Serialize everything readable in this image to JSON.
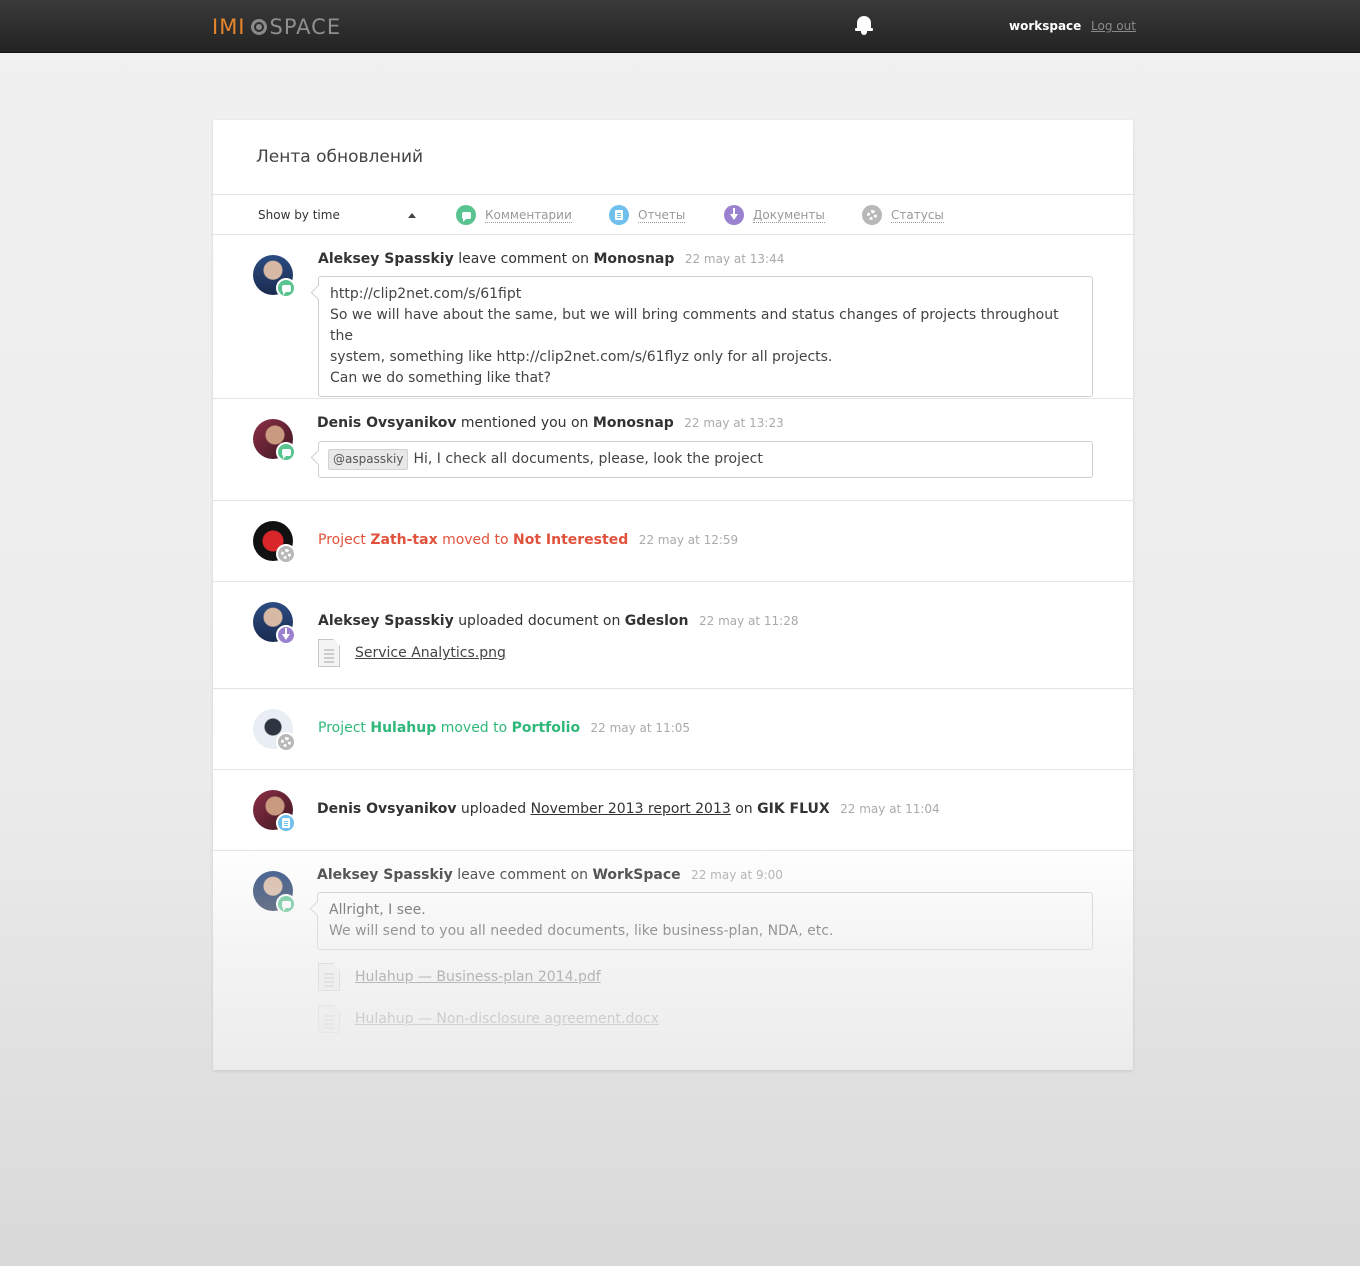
{
  "header": {
    "logo_left": "IMI",
    "logo_right": "SPACE",
    "workspace_label": "workspace",
    "logout_label": "Log out"
  },
  "page": {
    "title": "Лента обновлений",
    "sort_label": "Show by time"
  },
  "filters": [
    {
      "label": "Комментарии",
      "icon": "comment-icon",
      "color": "#5ac491"
    },
    {
      "label": "Отчеты",
      "icon": "report-icon",
      "color": "#6fc0ec"
    },
    {
      "label": "Документы",
      "icon": "download-icon",
      "color": "#9a82d1"
    },
    {
      "label": "Статусы",
      "icon": "gear-icon",
      "color": "#b8b8b8"
    }
  ],
  "feed": [
    {
      "user": "Aleksey Spasskiy",
      "action": "leave comment on",
      "target": "Monosnap",
      "time": "22 may at 13:44",
      "comment_lines": [
        "http://clip2net.com/s/61fipt",
        "So we will have about the same, but we will bring comments and status changes of projects throughout the",
        "system, something like http://clip2net.com/s/61flyz only for all projects.",
        "Can we do something like that?"
      ]
    },
    {
      "user": "Denis Ovsyanikov",
      "action": "mentioned you on",
      "target": "Monosnap",
      "time": "22 may at 13:23",
      "mention": "@aspasskiy",
      "comment": "Hi, I check all documents, please, look the project"
    },
    {
      "prefix": "Project",
      "project": "Zath-tax",
      "mid": "moved to",
      "status": "Not Interested",
      "time": "22 may at 12:59"
    },
    {
      "user": "Aleksey Spasskiy",
      "action": "uploaded document on",
      "target": "Gdeslon",
      "time": "22 may at 11:28",
      "file": "Service Analytics.png"
    },
    {
      "prefix": "Project",
      "project": "Hulahup",
      "mid": "moved to",
      "status": "Portfolio",
      "time": "22 may at 11:05"
    },
    {
      "user": "Denis Ovsyanikov",
      "action": "uploaded",
      "report": "November 2013 report 2013",
      "on": "on",
      "target": "GIK FLUX",
      "time": "22 may at 11:04"
    },
    {
      "user": "Aleksey Spasskiy",
      "action": "leave comment on",
      "target": "WorkSpace",
      "time": "22 may at 9:00",
      "comment_lines": [
        "Allright, I see.",
        "We will send to you all needed documents, like business-plan, NDA, etc."
      ],
      "files": [
        "Hulahup — Business-plan 2014.pdf",
        "Hulahup — Non-disclosure agreement.docx"
      ]
    }
  ]
}
